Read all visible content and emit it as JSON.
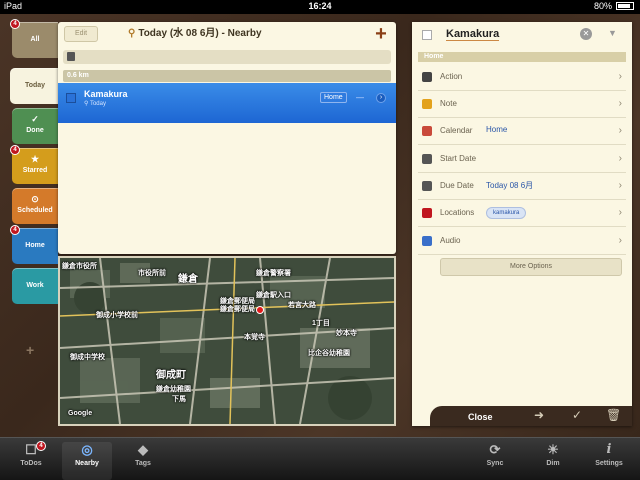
{
  "status_bar": {
    "carrier": "iPad",
    "time": "16:24",
    "battery": "80%"
  },
  "tabs": [
    {
      "label": "All",
      "color": "#9b8b6b",
      "badge": "4"
    },
    {
      "label": "Today",
      "color": "#f7f3df",
      "badge": ""
    },
    {
      "label": "Done",
      "color": "#4f8f52",
      "badge": "",
      "icon": "✓"
    },
    {
      "label": "Starred",
      "color": "#d49d1c",
      "badge": "4",
      "icon": "★"
    },
    {
      "label": "Scheduled",
      "color": "#d47a2a",
      "badge": "",
      "icon": "⊙"
    },
    {
      "label": "Home",
      "color": "#2a7ac0",
      "badge": "4"
    },
    {
      "label": "Work",
      "color": "#2a9aa3",
      "badge": ""
    }
  ],
  "list": {
    "edit_label": "Edit",
    "title": "Today (水 08 6月) - Nearby",
    "plus": "+",
    "distance": "0.6 km",
    "task": {
      "title": "Kamakura",
      "subtitle": "Today",
      "tag": "Home"
    }
  },
  "map": {
    "labels": [
      {
        "text": "鎌倉市役所"
      },
      {
        "text": "市役所前"
      },
      {
        "text": "鎌倉"
      },
      {
        "text": "鎌倉郵便局"
      },
      {
        "text": "鎌倉郵便局"
      },
      {
        "text": "御成小学校前"
      },
      {
        "text": "鎌倉駅入口"
      },
      {
        "text": "鎌倉警察署"
      },
      {
        "text": "若宮大路"
      },
      {
        "text": "1丁目"
      },
      {
        "text": "御成町"
      },
      {
        "text": "御成中学校"
      },
      {
        "text": "鎌倉幼稚園"
      },
      {
        "text": "下馬"
      },
      {
        "text": "比企谷幼稚園"
      },
      {
        "text": "本覚寺"
      },
      {
        "text": "妙本寺"
      },
      {
        "text": "Google"
      }
    ]
  },
  "detail": {
    "title": "Kamakura",
    "context": "Home",
    "rows": [
      {
        "label": "Action",
        "value": "",
        "icon_color": "#444"
      },
      {
        "label": "Note",
        "value": "",
        "icon_color": "#e3a21c"
      },
      {
        "label": "Calendar",
        "value": "Home",
        "icon_color": "#c94a3a"
      },
      {
        "label": "Start Date",
        "value": "",
        "icon_color": "#555"
      },
      {
        "label": "Due Date",
        "value": "Today 08 6月",
        "icon_color": "#555"
      },
      {
        "label": "Locations",
        "value": "kamakura",
        "icon_color": "#c0161f"
      },
      {
        "label": "Audio",
        "value": "",
        "icon_color": "#3a6fc9"
      }
    ],
    "more_options": "More Options",
    "close": "Close"
  },
  "toolbar": {
    "items": [
      {
        "label": "ToDos",
        "icon": "☐",
        "badge": "4"
      },
      {
        "label": "Nearby",
        "icon": "◎",
        "badge": ""
      },
      {
        "label": "Tags",
        "icon": "◆",
        "badge": ""
      },
      {
        "label": "Sync",
        "icon": "⟳",
        "badge": ""
      },
      {
        "label": "Dim",
        "icon": "☀",
        "badge": ""
      },
      {
        "label": "Settings",
        "icon": "i",
        "badge": ""
      }
    ]
  }
}
